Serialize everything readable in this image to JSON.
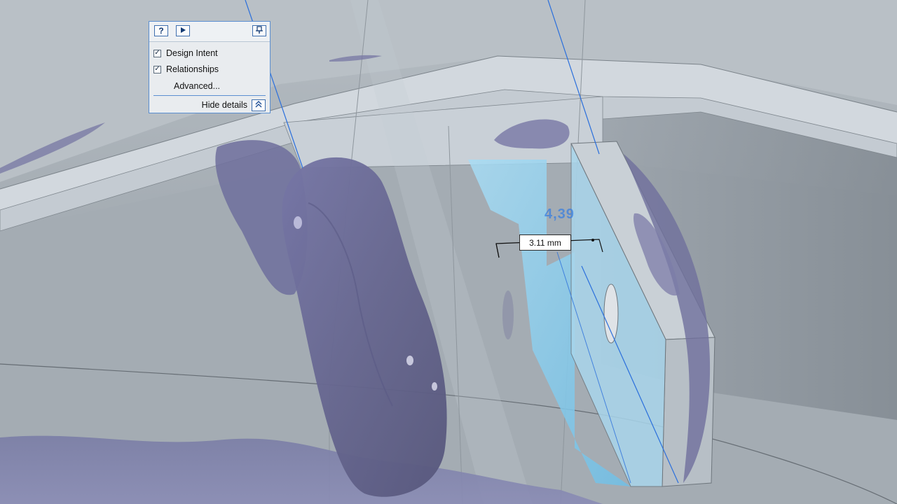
{
  "panel": {
    "help_icon": "question-mark-icon",
    "play_icon": "play-icon",
    "pin_icon": "pin-icon",
    "design_intent": {
      "label": "Design Intent",
      "checked": true
    },
    "relationships": {
      "label": "Relationships",
      "checked": true
    },
    "advanced_label": "Advanced...",
    "hide_details_label": "Hide details",
    "hide_icon": "double-chevron-up-icon",
    "accent_color": "#3f6fae"
  },
  "dimension": {
    "value_label": "3.11 mm",
    "ghost_label": "4,39",
    "ghost_color": "#3a7fe0"
  },
  "scene": {
    "colors": {
      "background": "#9aa3aa",
      "scan_mesh": "#6f6f9c",
      "highlight_plane": "#8fd0ee",
      "construction_line": "#2b6fdc"
    }
  }
}
